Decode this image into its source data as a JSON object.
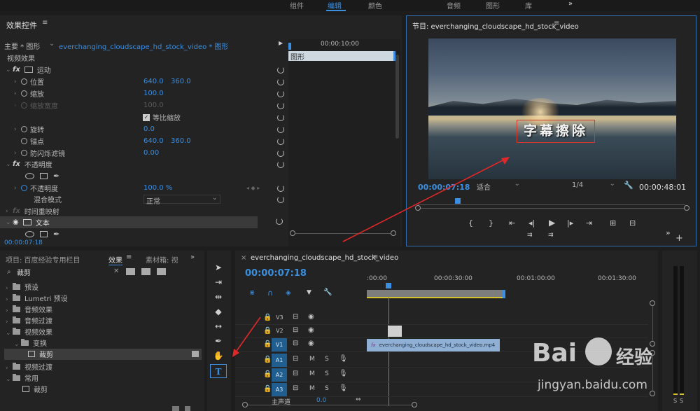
{
  "workspace_tabs": [
    "组件",
    "编辑",
    "颜色",
    "音频",
    "图形",
    "库"
  ],
  "workspace_active": "编辑",
  "workspace_more": "»",
  "effect_controls": {
    "title": "效果控件",
    "menu_icon": "≡",
    "master_label": "主要 * 图形",
    "clip_label": "everchanging_cloudscape_hd_stock_video * 图形",
    "timecode_ruler": "00:00:10:00",
    "clip_bar_label": "图形",
    "section_video": "视频效果",
    "motion": "运动",
    "position": "位置",
    "position_x": "640.0",
    "position_y": "360.0",
    "scale": "缩放",
    "scale_value": "100.0",
    "scale_width": "缩放宽度",
    "scale_width_value": "100.0",
    "uniform_scale": "等比缩放",
    "rotation": "旋转",
    "rotation_value": "0.0",
    "anchor": "锚点",
    "anchor_x": "640.0",
    "anchor_y": "360.0",
    "anti_flicker": "防闪烁滤镜",
    "anti_flicker_value": "0.00",
    "opacity_section": "不透明度",
    "opacity": "不透明度",
    "opacity_value": "100.0 %",
    "blend_mode": "混合模式",
    "blend_mode_value": "正常",
    "time_remap": "时间重映射",
    "text": "文本",
    "footer_timecode": "00:00:07:18"
  },
  "program_monitor": {
    "title": "节目: everchanging_cloudscape_hd_stock_video",
    "menu_icon": "≡",
    "overlay_text": "字幕擦除",
    "current_time": "00:00:07:18",
    "fit_label": "适合",
    "resolution_label": "1/4",
    "duration": "00:00:48:01"
  },
  "project_panel": {
    "tab_project": "项目: 百度经验专用栏目",
    "tab_effects": "效果",
    "tab_bin": "素材箱: 视",
    "more": "»",
    "search_value": "裁剪",
    "tree": [
      {
        "label": "预设",
        "indent": 0,
        "expanded": false
      },
      {
        "label": "Lumetri 预设",
        "indent": 0,
        "expanded": false
      },
      {
        "label": "音频效果",
        "indent": 0,
        "expanded": false
      },
      {
        "label": "音频过渡",
        "indent": 0,
        "expanded": false
      },
      {
        "label": "视频效果",
        "indent": 0,
        "expanded": true
      },
      {
        "label": "变换",
        "indent": 1,
        "expanded": true
      },
      {
        "label": "裁剪",
        "indent": 2,
        "expanded": false,
        "selected": true
      },
      {
        "label": "视频过渡",
        "indent": 0,
        "expanded": false
      },
      {
        "label": "常用",
        "indent": 0,
        "expanded": true
      },
      {
        "label": "裁剪",
        "indent": 1,
        "expanded": false
      }
    ]
  },
  "timeline": {
    "title": "everchanging_cloudscape_hd_stock_video",
    "menu_icon": "≡",
    "timecode": "00:00:07:18",
    "ruler_labels": [
      ":00:00",
      "00:00:30:00",
      "00:01:00:00",
      "00:01:30:00"
    ],
    "video_tracks": [
      "V3",
      "V2",
      "V1"
    ],
    "audio_tracks": [
      "A1",
      "A2",
      "A3"
    ],
    "mute": "M",
    "solo": "S",
    "master_label": "主声道",
    "master_value": "0.0",
    "clip_name": "everchanging_cloudscape_hd_stock_video.mp4",
    "clip_fx": "fx"
  },
  "audio_meter": {
    "labels": [
      "S",
      "S"
    ]
  },
  "watermark": {
    "text": "Bai",
    "subtext": "jingyan.baidu.com",
    "brand": "经验"
  }
}
